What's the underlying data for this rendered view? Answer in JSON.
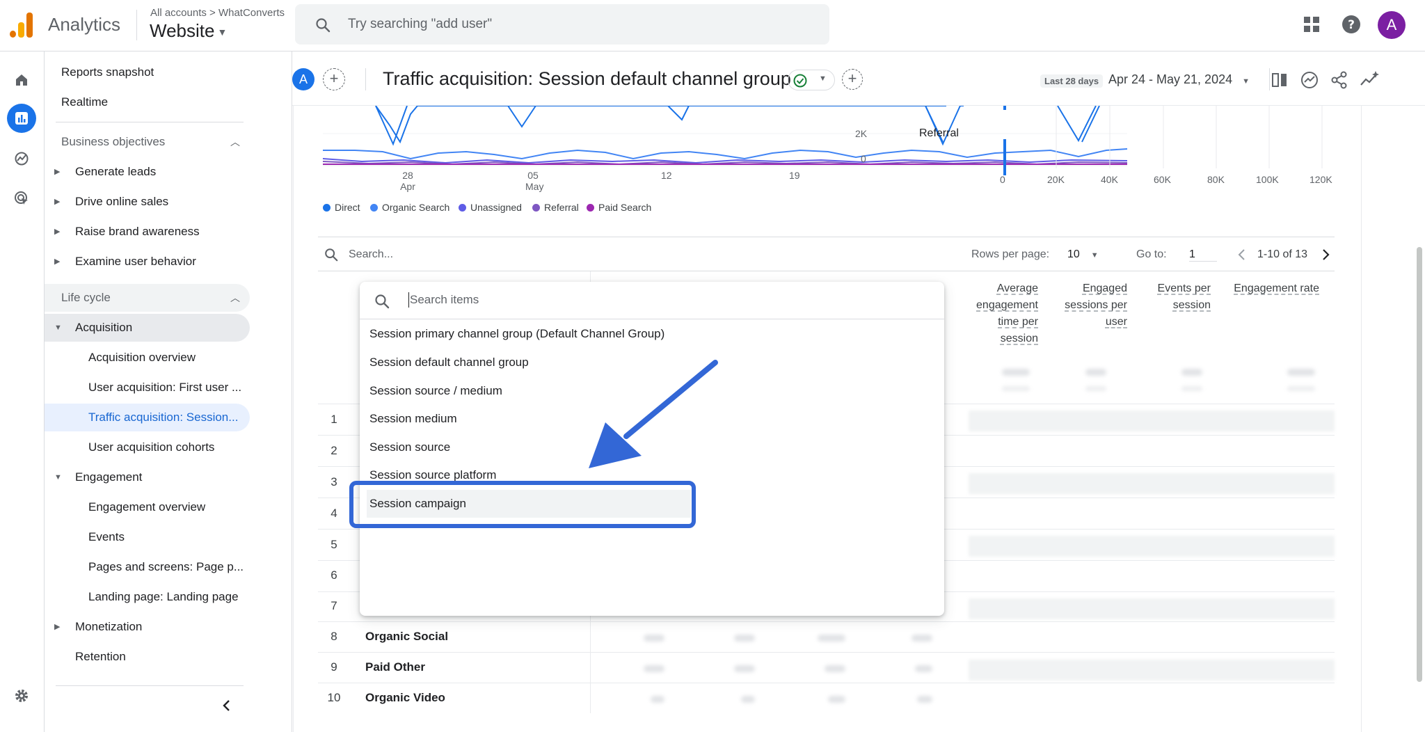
{
  "topbar": {
    "app_name": "Analytics",
    "breadcrumb": "All accounts > WhatConverts",
    "property": "Website",
    "search_placeholder": "Try searching \"add user\"",
    "avatar_letter": "A"
  },
  "sidebar": {
    "items": [
      {
        "label": "Reports snapshot"
      },
      {
        "label": "Realtime"
      },
      {
        "label": "Business objectives"
      },
      {
        "label": "Generate leads"
      },
      {
        "label": "Drive online sales"
      },
      {
        "label": "Raise brand awareness"
      },
      {
        "label": "Examine user behavior"
      },
      {
        "label": "Life cycle"
      },
      {
        "label": "Acquisition"
      },
      {
        "label": "Acquisition overview"
      },
      {
        "label": "User acquisition: First user ..."
      },
      {
        "label": "Traffic acquisition: Session..."
      },
      {
        "label": "User acquisition cohorts"
      },
      {
        "label": "Engagement"
      },
      {
        "label": "Engagement overview"
      },
      {
        "label": "Events"
      },
      {
        "label": "Pages and screens: Page p..."
      },
      {
        "label": "Landing page: Landing page"
      },
      {
        "label": "Monetization"
      },
      {
        "label": "Retention"
      }
    ]
  },
  "header": {
    "avatar_letter": "A",
    "title": "Traffic acquisition: Session default channel group",
    "date_label": "Last 28 days",
    "date_range": "Apr 24 - May 21, 2024"
  },
  "line_chart": {
    "y_ticks": [
      "2K",
      "0"
    ],
    "x_ticks": [
      {
        "day": "28",
        "month": "Apr"
      },
      {
        "day": "05",
        "month": "May"
      },
      {
        "day": "12",
        "month": ""
      },
      {
        "day": "19",
        "month": ""
      }
    ],
    "legend": [
      {
        "name": "Direct",
        "color": "#1a73e8"
      },
      {
        "name": "Organic Search",
        "color": "#4285f4"
      },
      {
        "name": "Unassigned",
        "color": "#5e5ce6"
      },
      {
        "name": "Referral",
        "color": "#7e57c2"
      },
      {
        "name": "Paid Search",
        "color": "#9c27b0"
      }
    ]
  },
  "bar_chart": {
    "category_label": "Referral",
    "x_ticks": [
      "0",
      "20K",
      "40K",
      "60K",
      "80K",
      "100K",
      "120K"
    ]
  },
  "table": {
    "search_placeholder": "Search...",
    "rows_per_page_label": "Rows per page:",
    "rows_per_page_value": "10",
    "goto_label": "Go to:",
    "goto_value": "1",
    "pagination": "1-10 of 13",
    "columns": [
      "Average engagement time per session",
      "Engaged sessions per user",
      "Events per session",
      "Engagement rate"
    ],
    "rows": [
      {
        "num": "1",
        "label": ""
      },
      {
        "num": "2",
        "label": ""
      },
      {
        "num": "3",
        "label": ""
      },
      {
        "num": "4",
        "label": ""
      },
      {
        "num": "5",
        "label": ""
      },
      {
        "num": "6",
        "label": ""
      },
      {
        "num": "7",
        "label": ""
      },
      {
        "num": "8",
        "label": "Organic Social"
      },
      {
        "num": "9",
        "label": "Paid Other"
      },
      {
        "num": "10",
        "label": "Organic Video"
      }
    ]
  },
  "dropdown": {
    "search_placeholder": "Search items",
    "items": [
      "Session primary channel group (Default Channel Group)",
      "Session default channel group",
      "Session source / medium",
      "Session medium",
      "Session source",
      "Session source platform",
      "Session campaign"
    ]
  },
  "colors": {
    "accent": "#1a73e8",
    "annotation": "#3367d6"
  }
}
